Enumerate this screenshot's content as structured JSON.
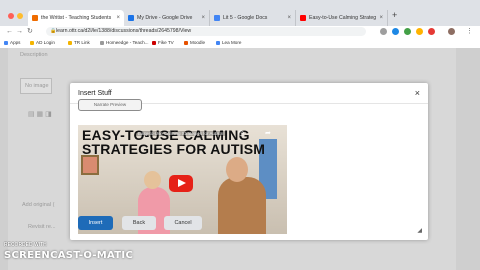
{
  "tabs": [
    {
      "label": "the Writist - Teaching Students",
      "color": "#ef6c00",
      "active": true
    },
    {
      "label": "My Drive - Google Drive",
      "color": "#1a73e8",
      "active": false
    },
    {
      "label": "Lit 5 - Google Docs",
      "color": "#4285f4",
      "active": false
    },
    {
      "label": "Easy-to-Use Calming Strateg",
      "color": "#ff0000",
      "active": false
    }
  ],
  "address": {
    "url": "learn.ottr.ca/d2l/le/1388/discussions/threads/2645798/View"
  },
  "bookmarks": [
    {
      "label": "Apps",
      "color": "#4285f4"
    },
    {
      "label": "AD Login",
      "color": "#f4b400"
    },
    {
      "label": "TR Link",
      "color": "#f4b400"
    },
    {
      "label": "Homeedge - Teach...",
      "color": "#999999"
    },
    {
      "label": "Fike TV",
      "color": "#cc0000"
    },
    {
      "label": "Moodle",
      "color": "#e65100"
    },
    {
      "label": "Lea More",
      "color": "#4285f4"
    }
  ],
  "background": {
    "description": "Description",
    "title": "No image",
    "add_original": "Add original (",
    "reminder": "Revisit re..."
  },
  "modal": {
    "title": "Insert Stuff",
    "preview_button": "Narrate Preview",
    "video": {
      "title": "EASY-TO-USE CALMING STRATEGIES FOR AUTISM",
      "meta": "Easy-to-Use Calming Strategies for Autism"
    },
    "buttons": {
      "insert": "Insert",
      "back": "Back",
      "cancel": "Cancel"
    }
  },
  "watermark": {
    "line1": "RECORDED WITH",
    "line2": "SCREENCAST-O-MATIC"
  }
}
